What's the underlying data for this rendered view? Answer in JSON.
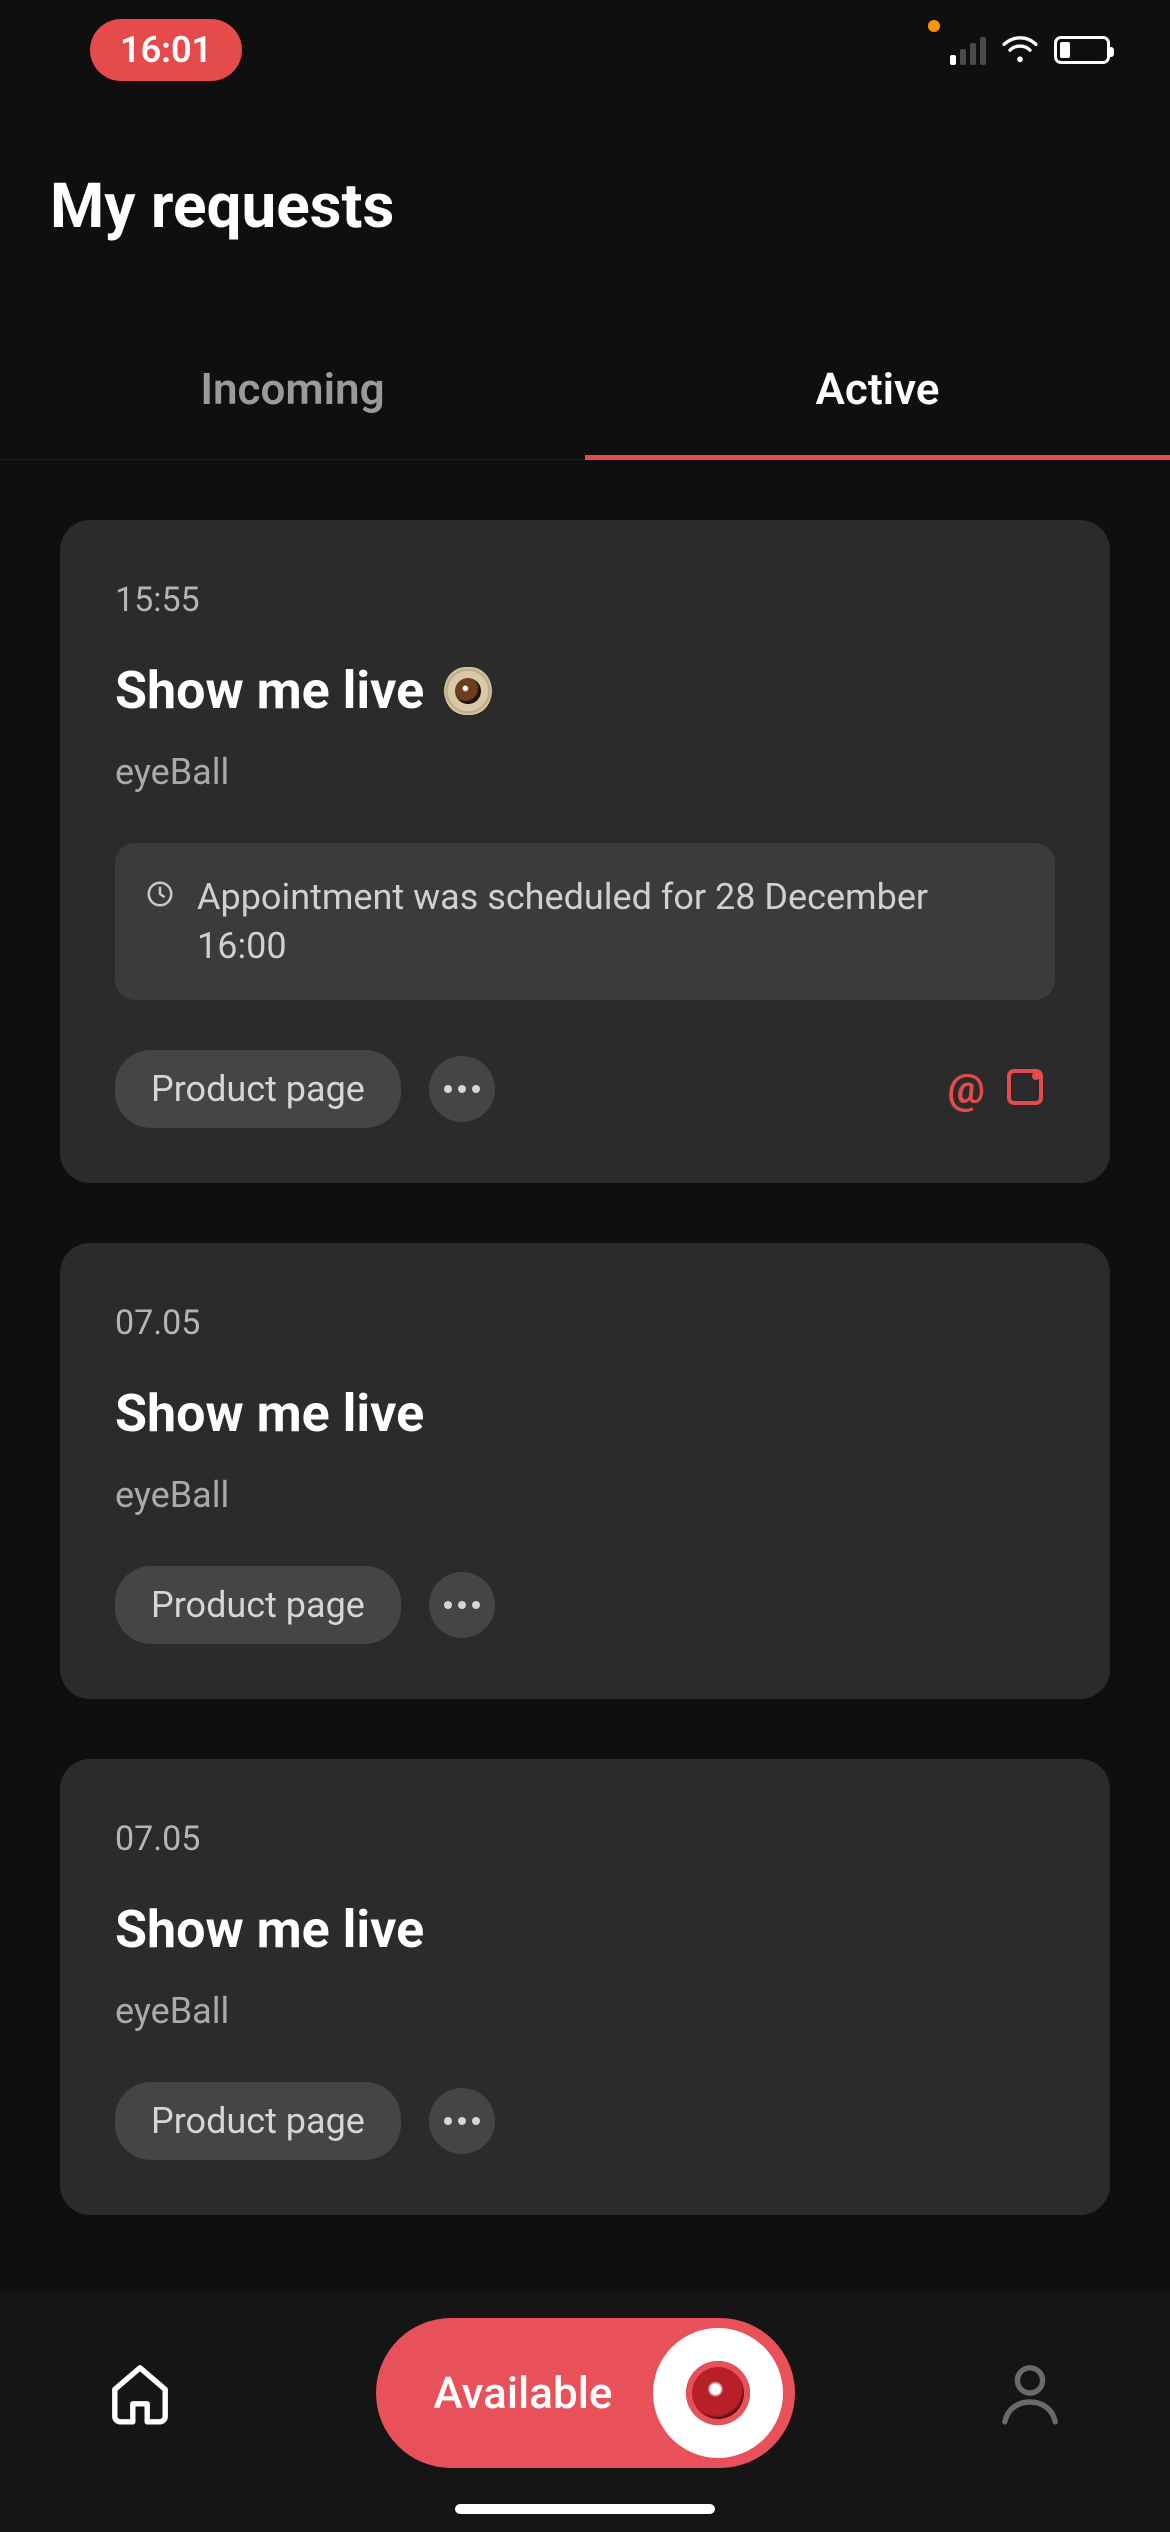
{
  "status": {
    "time": "16:01"
  },
  "header": {
    "title": "My requests"
  },
  "tabs": {
    "incoming": "Incoming",
    "active": "Active"
  },
  "requests": [
    {
      "time": "15:55",
      "title": "Show me live",
      "has_eye": true,
      "subtitle": "eyeBall",
      "appointment": "Appointment was scheduled for 28 December 16:00",
      "chip": "Product page",
      "side_icons": true
    },
    {
      "time": "07.05",
      "title": "Show me live",
      "has_eye": false,
      "subtitle": "eyeBall",
      "appointment": null,
      "chip": "Product page",
      "side_icons": false
    },
    {
      "time": "07.05",
      "title": "Show me live",
      "has_eye": false,
      "subtitle": "eyeBall",
      "appointment": null,
      "chip": "Product page",
      "side_icons": false
    }
  ],
  "bottom": {
    "availability_label": "Available"
  }
}
